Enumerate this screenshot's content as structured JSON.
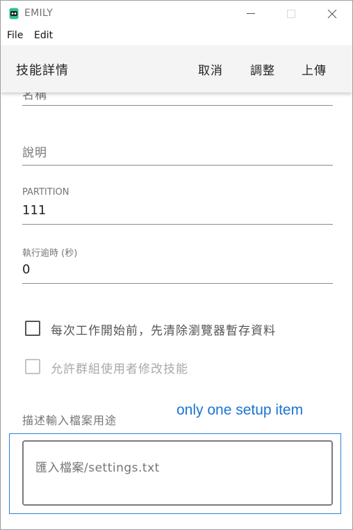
{
  "window": {
    "title": "EMILY"
  },
  "menu": {
    "file": "File",
    "edit": "Edit"
  },
  "appbar": {
    "title": "技能詳情",
    "cancel": "取消",
    "adjust": "調整",
    "upload": "上傳"
  },
  "form": {
    "name_label_partial": "名稱",
    "description_placeholder": "說明",
    "partition": {
      "label": "PARTITION",
      "value": "111"
    },
    "timeout": {
      "label": "執行逾時 (秒)",
      "value": "0"
    },
    "checkbox_clear_cache": {
      "label": "每次工作開始前，先清除瀏覽器暫存資料",
      "checked": false
    },
    "checkbox_allow_group": {
      "label": "允許群組使用者修改技能",
      "checked": false,
      "disabled": true
    },
    "input_file_desc": {
      "label": "描述輸入檔案用途",
      "value": "匯入檔案/settings.txt"
    }
  },
  "annotation": {
    "text": "only one setup item",
    "color": "#1a74d2"
  }
}
